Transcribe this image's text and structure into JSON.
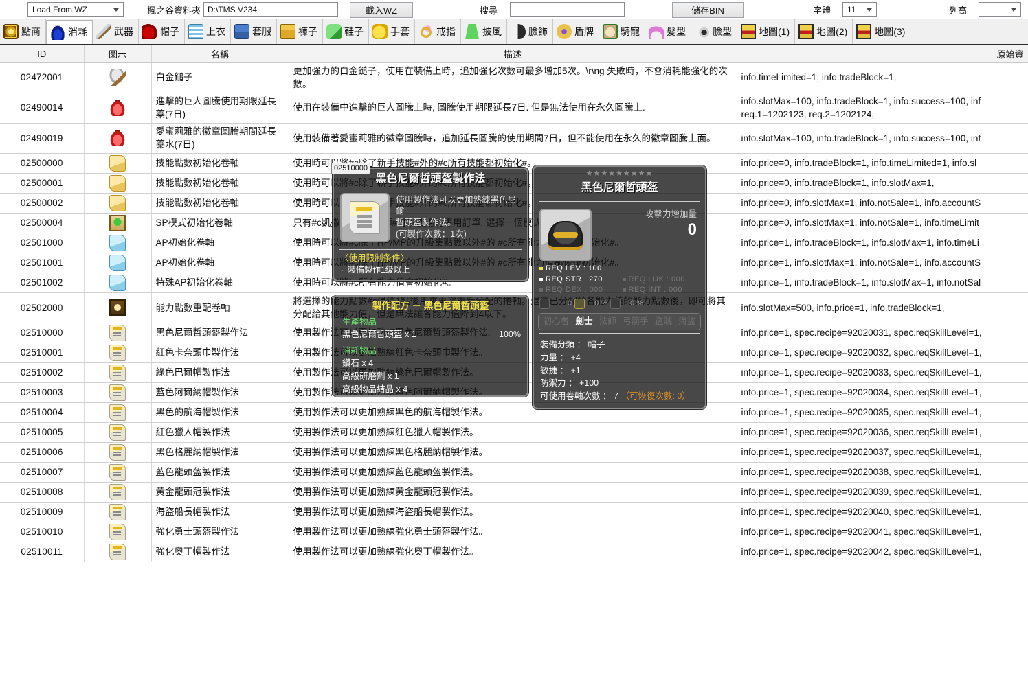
{
  "toolbar": {
    "load_mode": "Load From WZ",
    "folder_label": "楓之谷資料夾",
    "folder_path": "D:\\TMS V234",
    "load_button": "載入WZ",
    "search_label": "搜尋",
    "search_value": "",
    "save_button": "儲存BIN",
    "font_label": "字體",
    "font_size": "11",
    "rowheight_label": "列高",
    "rowheight_value": ""
  },
  "tabs": [
    {
      "label": "點商",
      "icon": "cash-shop-icon",
      "active": false
    },
    {
      "label": "消耗",
      "icon": "potion-icon",
      "active": true
    },
    {
      "label": "武器",
      "icon": "weapon-icon",
      "active": false
    },
    {
      "label": "帽子",
      "icon": "hat-icon",
      "active": false
    },
    {
      "label": "上衣",
      "icon": "shirt-icon",
      "active": false
    },
    {
      "label": "套服",
      "icon": "overall-icon",
      "active": false
    },
    {
      "label": "褲子",
      "icon": "pants-icon",
      "active": false
    },
    {
      "label": "鞋子",
      "icon": "shoes-icon",
      "active": false
    },
    {
      "label": "手套",
      "icon": "glove-icon",
      "active": false
    },
    {
      "label": "戒指",
      "icon": "ring-icon",
      "active": false
    },
    {
      "label": "披風",
      "icon": "cape-icon",
      "active": false
    },
    {
      "label": "臉飾",
      "icon": "face-acc-icon",
      "active": false
    },
    {
      "label": "盾牌",
      "icon": "shield-icon",
      "active": false
    },
    {
      "label": "騎寵",
      "icon": "pet-icon",
      "active": false
    },
    {
      "label": "髮型",
      "icon": "hair-icon",
      "active": false
    },
    {
      "label": "臉型",
      "icon": "eye-icon",
      "active": false
    },
    {
      "label": "地圖(1)",
      "icon": "map-icon",
      "active": false
    },
    {
      "label": "地圖(2)",
      "icon": "map-icon",
      "active": false
    },
    {
      "label": "地圖(3)",
      "icon": "map-icon",
      "active": false
    }
  ],
  "grid": {
    "columns": [
      "ID",
      "圖示",
      "名稱",
      "描述",
      "原始資"
    ],
    "selected_row_id": "02510000",
    "rows": [
      {
        "id": "02472001",
        "icon": "hammer-icon",
        "name": "白金鎚子",
        "desc": "更加強力的白金鎚子，使用在裝備上時，追加強化次數可最多增加5次。\\r\\ng 失敗時，不會消耗能強化的次數。",
        "raw": "info.timeLimited=1,  info.tradeBlock=1,"
      },
      {
        "id": "02490014",
        "icon": "red-potion-icon",
        "name": "進擊的巨人圖騰使用期限延長藥(7日)",
        "desc": "使用在裝備中進擊的巨人圖騰上時, 圖騰使用期限延長7日. 但是無法使用在永久圖騰上.",
        "raw": "info.slotMax=100,  info.tradeBlock=1,  info.success=100,  inf\nreq.1=1202123,  req.2=1202124,"
      },
      {
        "id": "02490019",
        "icon": "red-potion-icon",
        "name": "愛蜜莉雅的徽章圖騰期間延長藥水(7日)",
        "desc": "使用裝備著愛蜜莉雅的徽章圖騰時，追加延長圖騰的使用期間7日，但不能使用在永久的徽章圖騰上面。",
        "raw": "info.slotMax=100,  info.tradeBlock=1,  info.success=100,  inf"
      },
      {
        "id": "02500000",
        "icon": "yellow-scroll-icon",
        "name": "技能點數初始化卷軸",
        "desc": "使用時可以將#c除了新手技能#外的#c所有技能都初始化#。",
        "raw": "info.price=0,  info.tradeBlock=1,  info.timeLimited=1,  info.sl"
      },
      {
        "id": "02500001",
        "icon": "yellow-scroll-icon",
        "name": "技能點數初始化卷軸",
        "desc": "使用時可以將#c除了新手技能#外的#c所有技能都初始化#。",
        "raw": "info.price=0,  info.tradeBlock=1,  info.slotMax=1,"
      },
      {
        "id": "02500002",
        "icon": "yellow-scroll-icon",
        "name": "技能點數初始化卷軸",
        "desc": "使用時可以將#c除了新手技能#外的#c所有技能都初始化#。",
        "raw": "info.price=0,  info.slotMax=1,  info.notSale=1,  info.accountS"
      },
      {
        "id": "02500004",
        "icon": "sp-mode-icon",
        "name": "SP模式初始化卷軸",
        "desc": "只有#c凱撒#和#c魔獸師#可以使用的專用訂單, 選擇一個模式可以",
        "raw": "info.price=0,  info.slotMax=1,  info.notSale=1,  info.timeLimit"
      },
      {
        "id": "02501000",
        "icon": "blue-scroll-icon",
        "name": "AP初始化卷軸",
        "desc": "使用時可以將#c除了HP/MP的升級集點數以外#的 #c所有能力值都恢復初始化#。",
        "raw": "info.price=1,  info.tradeBlock=1,  info.slotMax=1,  info.timeLi"
      },
      {
        "id": "02501001",
        "icon": "blue-scroll-icon",
        "name": "AP初始化卷軸",
        "desc": "使用時可以將#c除了HP/MP的升級集點數以外#的 #c所有能力值都恢復初始化#。",
        "raw": "info.price=1,  info.slotMax=1,  info.notSale=1,  info.accountS"
      },
      {
        "id": "02501002",
        "icon": "blue-scroll-icon",
        "name": "特殊AP初始化卷軸",
        "desc": "使用時可以將#c所有能力值會初始化#。",
        "raw": "info.price=1,  info.tradeBlock=1,  info.slotMax=1,  info.notSal"
      },
      {
        "id": "02502000",
        "icon": "ability-reset-icon",
        "name": "能力點數重配卷軸",
        "desc": "將選擇的能力點數#c退還1點後用來再次重新分配的捲軸。退還已分配於各能力值的能力點數後，即可將其分配給其他能力值，但是無法讓各能力值降到4以下。",
        "raw": "info.slotMax=500,  info.price=1,  info.tradeBlock=1,"
      },
      {
        "id": "02510000",
        "icon": "recipe-icon",
        "name": "黑色尼爾哲頭盔製作法",
        "desc": "使用製作法可以更加熟練黑色尼爾哲頭盔製作法。",
        "raw": "info.price=1,  spec.recipe=92020031,  spec.reqSkillLevel=1,"
      },
      {
        "id": "02510001",
        "icon": "recipe-icon",
        "name": "紅色卡奈頭巾製作法",
        "desc": "使用製作法可以更加熟練紅色卡奈頭巾製作法。",
        "raw": "info.price=1,  spec.recipe=92020032,  spec.reqSkillLevel=1,"
      },
      {
        "id": "02510002",
        "icon": "recipe-icon",
        "name": "綠色巴爾帽製作法",
        "desc": "使用製作法可以更加熟練綠色巴爾帽製作法。",
        "raw": "info.price=1,  spec.recipe=92020033,  spec.reqSkillLevel=1,"
      },
      {
        "id": "02510003",
        "icon": "recipe-icon",
        "name": "藍色阿爾納帽製作法",
        "desc": "使用製作法可以更加熟練藍色阿爾納帽製作法。",
        "raw": "info.price=1,  spec.recipe=92020034,  spec.reqSkillLevel=1,"
      },
      {
        "id": "02510004",
        "icon": "recipe-icon",
        "name": "黑色的航海帽製作法",
        "desc": "使用製作法可以更加熟練黑色的航海帽製作法。",
        "raw": "info.price=1,  spec.recipe=92020035,  spec.reqSkillLevel=1,"
      },
      {
        "id": "02510005",
        "icon": "recipe-icon",
        "name": "紅色獵人帽製作法",
        "desc": "使用製作法可以更加熟練紅色獵人帽製作法。",
        "raw": "info.price=1,  spec.recipe=92020036,  spec.reqSkillLevel=1,"
      },
      {
        "id": "02510006",
        "icon": "recipe-icon",
        "name": "黑色格麗納帽製作法",
        "desc": "使用製作法可以更加熟練黑色格麗納帽製作法。",
        "raw": "info.price=1,  spec.recipe=92020037,  spec.reqSkillLevel=1,"
      },
      {
        "id": "02510007",
        "icon": "recipe-icon",
        "name": "藍色龍頭盔製作法",
        "desc": "使用製作法可以更加熟練藍色龍頭盔製作法。",
        "raw": "info.price=1,  spec.recipe=92020038,  spec.reqSkillLevel=1,"
      },
      {
        "id": "02510008",
        "icon": "recipe-icon",
        "name": "黃金龍頭冠製作法",
        "desc": "使用製作法可以更加熟練黃金龍頭冠製作法。",
        "raw": "info.price=1,  spec.recipe=92020039,  spec.reqSkillLevel=1,"
      },
      {
        "id": "02510009",
        "icon": "recipe-icon",
        "name": "海盜船長帽製作法",
        "desc": "使用製作法可以更加熟練海盜船長帽製作法。",
        "raw": "info.price=1,  spec.recipe=92020040,  spec.reqSkillLevel=1,"
      },
      {
        "id": "02510010",
        "icon": "recipe-icon",
        "name": "強化勇士頭盔製作法",
        "desc": "使用製作法可以更加熟練強化勇士頭盔製作法。",
        "raw": "info.price=1,  spec.recipe=92020041,  spec.reqSkillLevel=1,"
      },
      {
        "id": "02510011",
        "icon": "recipe-icon",
        "name": "強化奧丁帽製作法",
        "desc": "使用製作法可以更加熟練強化奧丁帽製作法。",
        "raw": "info.price=1,  spec.recipe=92020042,  spec.reqSkillLevel=1,"
      }
    ]
  },
  "tooltip_recipe": {
    "id_tag": "02510000",
    "title": "黑色尼爾哲頭盔製作法",
    "desc_line1": "使用製作法可以更加熟練黑色尼爾",
    "desc_line2": "哲頭盔製作法。",
    "desc_line3": "(可製作次數：1次)",
    "condition_title": "〈使用限制条件〉",
    "condition_item": "裝備製作1级以上"
  },
  "tooltip_formula": {
    "title": "製作配方 － 黑色尼爾哲頭盔",
    "produce_header": "生產物品",
    "produce_item": "黑色尼爾哲頭盔 x 1",
    "produce_rate": "100%",
    "consume_header": "消耗物品",
    "consume_items": [
      "鑽石 x 4",
      "高級研磨劑 x 1",
      "高級物品結晶 x 4"
    ]
  },
  "tooltip_item": {
    "stars": "★★★★★★★★★",
    "title": "黑色尼爾哲頭盔",
    "atk_label": "攻擊力增加量",
    "atk_value": "0",
    "req_lev": "REQ LEV : 100",
    "req_str": "REQ STR : 270",
    "req_luk": "REQ LUK : 000",
    "req_dex": "REQ DEX : 000",
    "req_int": "REQ INT : 000",
    "potential_values": [
      "0",
      "0 %",
      "0 %"
    ],
    "jobs": [
      {
        "label": "初心者",
        "enabled": false
      },
      {
        "label": "劍士",
        "enabled": true
      },
      {
        "label": "法師",
        "enabled": false
      },
      {
        "label": "弓箭手",
        "enabled": false
      },
      {
        "label": "盜賊",
        "enabled": false
      },
      {
        "label": "海盜",
        "enabled": false
      }
    ],
    "stats": [
      "裝備分類 ： 帽子",
      "力量 ： +4",
      "敏捷 ： +1",
      "防禦力 ： +100"
    ],
    "scroll_line_label": "可使用卷軸次數 ： 7",
    "scroll_line_extra": "（可恢復次數: 0）"
  }
}
